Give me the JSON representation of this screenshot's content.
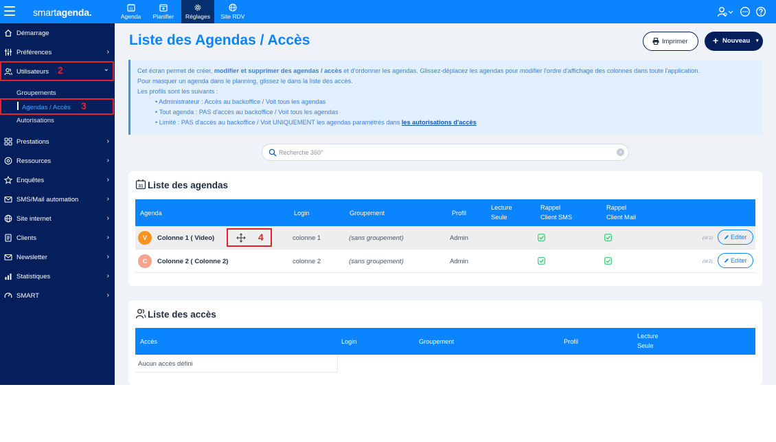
{
  "topbar": {
    "brand_light": "smart",
    "brand_bold": "agenda.",
    "tabs": [
      {
        "label": "Agenda",
        "icon": "calendar-31-icon"
      },
      {
        "label": "Planifier",
        "icon": "calendar-plan-icon"
      },
      {
        "label": "Réglages",
        "icon": "gear-icon",
        "active": true
      },
      {
        "label": "Site RDV",
        "icon": "globe-icon"
      }
    ],
    "right_icons": [
      "user-settings-icon",
      "chat-icon",
      "help-icon"
    ]
  },
  "sidebar": {
    "items": [
      {
        "label": "Démarrage",
        "icon": "home-icon",
        "chevron": ""
      },
      {
        "label": "Préférences",
        "icon": "sliders-icon",
        "chevron": "›"
      },
      {
        "label": "Utilisateurs",
        "icon": "users-icon",
        "chevron": "⌄"
      },
      {
        "label": "Prestations",
        "icon": "grid-icon",
        "chevron": "›"
      },
      {
        "label": "Ressources",
        "icon": "resources-icon",
        "chevron": "›"
      },
      {
        "label": "Enquêtes",
        "icon": "star-icon",
        "chevron": "›"
      },
      {
        "label": "SMS/Mail automation",
        "icon": "mail-icon",
        "chevron": "›"
      },
      {
        "label": "Site internet",
        "icon": "globe-icon",
        "chevron": "›"
      },
      {
        "label": "Clients",
        "icon": "contacts-icon",
        "chevron": "›"
      },
      {
        "label": "Newsletter",
        "icon": "envelope-icon",
        "chevron": "›"
      },
      {
        "label": "Statistiques",
        "icon": "stats-icon",
        "chevron": "›"
      },
      {
        "label": "SMART",
        "icon": "gauge-icon",
        "chevron": "›"
      }
    ],
    "subitems": [
      "Groupements",
      "Agendas / Accès",
      "Autorisations"
    ]
  },
  "annotations": {
    "a2": "2",
    "a3": "3",
    "a4": "4"
  },
  "main": {
    "title": "Liste des Agendas / Accès",
    "print_label": "Imprimer",
    "new_label": "Nouveau",
    "info": {
      "l1_a": "Cet écran permet de créer, ",
      "l1_b": "modifier et supprimer des agendas / accès",
      "l1_c": " et d'ordonner les agendas. Glissez-déplacez les agendas pour modifier l'ordre d'affichage des colonnes dans toute l'application.",
      "l2": "Pour masquer un agenda dans le planning, glissez le dans la liste des accès.",
      "l3": "Les profils sont les suivants :",
      "p1": "• Administrateur : Accès au backoffice / Voit tous les agendas",
      "p2": "• Tout agenda : PAS d'accès au backoffice / Voit tous les agendas",
      "p3_a": "• Limité : PAS d'accès au backoffice / Voit UNIQUEMENT les agendas paramétrés dans ",
      "p3_link": "les autorisations d'accès"
    },
    "search_placeholder": "Recherche 360°",
    "agendas": {
      "title": "Liste des agendas",
      "headers": {
        "agenda": "Agenda",
        "login": "Login",
        "groupement": "Groupement",
        "profil": "Profil",
        "lecture_1": "Lecture",
        "lecture_2": "Seule",
        "sms_1": "Rappel",
        "sms_2": "Client SMS",
        "mail_1": "Rappel",
        "mail_2": "Client Mail"
      },
      "rows": [
        {
          "initial": "V",
          "color": "#f7931e",
          "name": "Colonne 1 ( Video)",
          "login": "colonne 1",
          "groupement": "(sans groupement)",
          "profil": "Admin",
          "sms": true,
          "mail": true,
          "id": "(id:1)",
          "edit": "Editer"
        },
        {
          "initial": "C",
          "color": "#f4a38d",
          "name": "Colonne 2 ( Colonne 2)",
          "login": "colonne 2",
          "groupement": "(sans groupement)",
          "profil": "Admin",
          "sms": true,
          "mail": true,
          "id": "(id:2)",
          "edit": "Editer"
        }
      ]
    },
    "acces": {
      "title": "Liste des accès",
      "headers": {
        "acces": "Accès",
        "login": "Login",
        "groupement": "Groupement",
        "profil": "Profil",
        "lecture_1": "Lecture",
        "lecture_2": "Seule"
      },
      "empty": "Aucun accès défini"
    }
  },
  "colors": {
    "primary": "#0a84ff",
    "sidebar": "#041f5c",
    "annotation": "#e5232c",
    "check": "#2ecc71"
  }
}
